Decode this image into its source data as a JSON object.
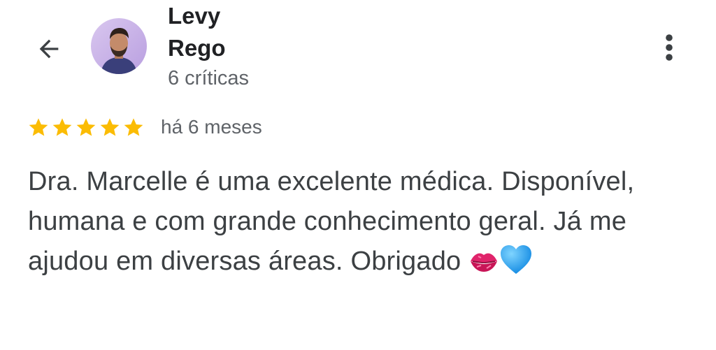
{
  "header": {
    "back_icon": "arrow-back-icon",
    "reviewer_name": "Levy Rego",
    "review_count": "6 críticas",
    "more_icon": "more-vert-icon"
  },
  "review": {
    "rating": 5,
    "rating_max": 5,
    "star_color": "#fbbc04",
    "date": "há 6 meses",
    "text": "Dra. Marcelle é uma excelente médica. Disponível, humana e com grande conhecimento geral. Já me ajudou em diversas áreas. Obrigado",
    "emojis": [
      "kiss-mark-icon",
      "blue-heart-icon"
    ]
  }
}
